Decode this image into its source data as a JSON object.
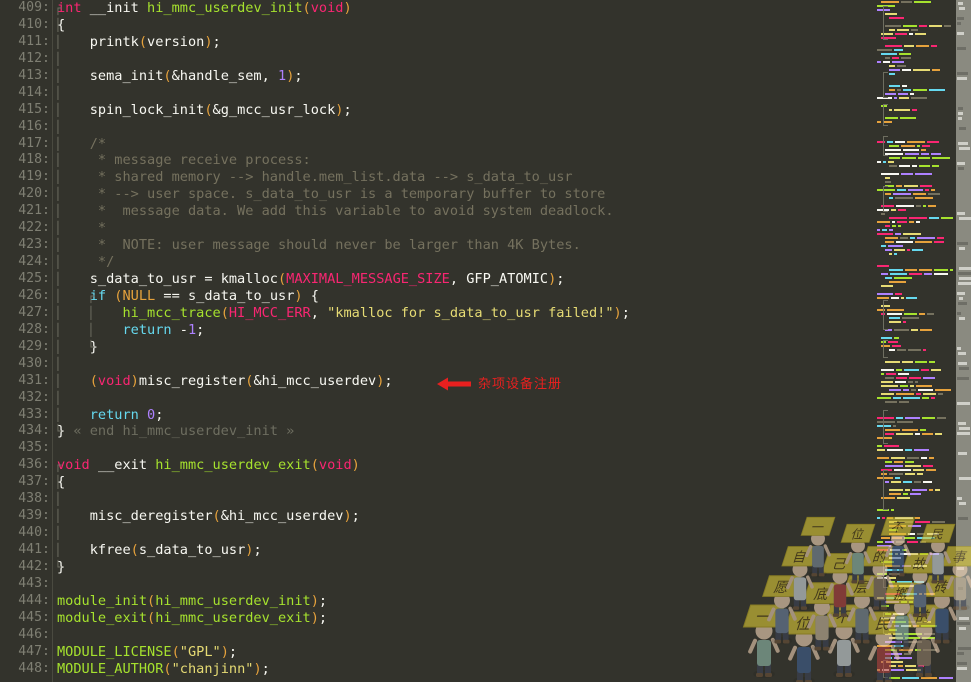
{
  "editor": {
    "theme": "monokai",
    "background": "#33332c",
    "gutter_color": "#7f7f73",
    "first_line": 409,
    "last_line": 448,
    "lines": [
      {
        "n": 409,
        "fold": "open",
        "tokens": [
          {
            "t": "int",
            "c": "kw"
          },
          {
            "t": " ",
            "c": "pln"
          },
          {
            "t": "__init",
            "c": "pln"
          },
          {
            "t": " ",
            "c": "pln"
          },
          {
            "t": "hi_mmc_userdev_init",
            "c": "fn"
          },
          {
            "t": "(",
            "c": "par"
          },
          {
            "t": "void",
            "c": "kw"
          },
          {
            "t": ")",
            "c": "par"
          }
        ]
      },
      {
        "n": 410,
        "fold": "bar",
        "tokens": [
          {
            "t": "{",
            "c": "pln"
          }
        ]
      },
      {
        "n": 411,
        "fold": "bar",
        "tokens": [
          {
            "t": "    printk",
            "c": "pln"
          },
          {
            "t": "(",
            "c": "par"
          },
          {
            "t": "version",
            "c": "pln"
          },
          {
            "t": ")",
            "c": "par"
          },
          {
            "t": ";",
            "c": "pln"
          }
        ]
      },
      {
        "n": 412,
        "fold": "bar",
        "tokens": []
      },
      {
        "n": 413,
        "fold": "bar",
        "tokens": [
          {
            "t": "    sema_init",
            "c": "pln"
          },
          {
            "t": "(",
            "c": "par"
          },
          {
            "t": "&handle_sem, ",
            "c": "pln"
          },
          {
            "t": "1",
            "c": "num"
          },
          {
            "t": ")",
            "c": "par"
          },
          {
            "t": ";",
            "c": "pln"
          }
        ]
      },
      {
        "n": 414,
        "fold": "bar",
        "tokens": []
      },
      {
        "n": 415,
        "fold": "bar",
        "tokens": [
          {
            "t": "    spin_lock_init",
            "c": "pln"
          },
          {
            "t": "(",
            "c": "par"
          },
          {
            "t": "&g_mcc_usr_lock",
            "c": "pln"
          },
          {
            "t": ")",
            "c": "par"
          },
          {
            "t": ";",
            "c": "pln"
          }
        ]
      },
      {
        "n": 416,
        "fold": "bar",
        "tokens": []
      },
      {
        "n": 417,
        "fold": "bar",
        "tokens": [
          {
            "t": "    /*",
            "c": "cmt"
          }
        ]
      },
      {
        "n": 418,
        "fold": "bar",
        "tokens": [
          {
            "t": "     * message receive process:",
            "c": "cmt"
          }
        ]
      },
      {
        "n": 419,
        "fold": "bar",
        "tokens": [
          {
            "t": "     * shared memory --> handle.mem_list.data --> s_data_to_usr",
            "c": "cmt"
          }
        ]
      },
      {
        "n": 420,
        "fold": "bar",
        "tokens": [
          {
            "t": "     * --> user space. s_data_to_usr is a temporary buffer to store",
            "c": "cmt"
          }
        ]
      },
      {
        "n": 421,
        "fold": "bar",
        "tokens": [
          {
            "t": "     *  message data. We add this variable to avoid system deadlock.",
            "c": "cmt"
          }
        ]
      },
      {
        "n": 422,
        "fold": "bar",
        "tokens": [
          {
            "t": "     *",
            "c": "cmt"
          }
        ]
      },
      {
        "n": 423,
        "fold": "bar",
        "tokens": [
          {
            "t": "     *  NOTE: user message should never be larger than 4K Bytes.",
            "c": "cmt"
          }
        ]
      },
      {
        "n": 424,
        "fold": "bar",
        "tokens": [
          {
            "t": "     */",
            "c": "cmt"
          }
        ]
      },
      {
        "n": 425,
        "fold": "bar",
        "tokens": [
          {
            "t": "    s_data_to_usr = ",
            "c": "pln"
          },
          {
            "t": "kmalloc",
            "c": "pln"
          },
          {
            "t": "(",
            "c": "par"
          },
          {
            "t": "MAXIMAL_MESSAGE_SIZE",
            "c": "cst"
          },
          {
            "t": ", GFP_ATOMIC",
            "c": "pln"
          },
          {
            "t": ")",
            "c": "par"
          },
          {
            "t": ";",
            "c": "pln"
          }
        ]
      },
      {
        "n": 426,
        "fold": "bar",
        "inner": "open",
        "tokens": [
          {
            "t": "    ",
            "c": "pln"
          },
          {
            "t": "if",
            "c": "ctl"
          },
          {
            "t": " (",
            "c": "par"
          },
          {
            "t": "NULL",
            "c": "par"
          },
          {
            "t": " == s_data_to_usr",
            "c": "pln"
          },
          {
            "t": ")",
            "c": "par"
          },
          {
            "t": " {",
            "c": "pln"
          }
        ]
      },
      {
        "n": 427,
        "fold": "bar",
        "inner": "bar",
        "tokens": [
          {
            "t": "        hi_mcc_trace",
            "c": "fn"
          },
          {
            "t": "(",
            "c": "par"
          },
          {
            "t": "HI_MCC_ERR",
            "c": "cst"
          },
          {
            "t": ", ",
            "c": "pln"
          },
          {
            "t": "\"kmalloc for s_data_to_usr failed!\"",
            "c": "str"
          },
          {
            "t": ")",
            "c": "par"
          },
          {
            "t": ";",
            "c": "pln"
          }
        ]
      },
      {
        "n": 428,
        "fold": "bar",
        "inner": "bar",
        "tokens": [
          {
            "t": "        ",
            "c": "pln"
          },
          {
            "t": "return",
            "c": "ctl"
          },
          {
            "t": " -",
            "c": "pln"
          },
          {
            "t": "1",
            "c": "num"
          },
          {
            "t": ";",
            "c": "pln"
          }
        ]
      },
      {
        "n": 429,
        "fold": "bar",
        "inner": "close",
        "tokens": [
          {
            "t": "    }",
            "c": "pln"
          }
        ]
      },
      {
        "n": 430,
        "fold": "bar",
        "tokens": []
      },
      {
        "n": 431,
        "fold": "bar",
        "tokens": [
          {
            "t": "    (",
            "c": "par"
          },
          {
            "t": "void",
            "c": "kw"
          },
          {
            "t": ")",
            "c": "par"
          },
          {
            "t": "misc_register",
            "c": "pln"
          },
          {
            "t": "(",
            "c": "par"
          },
          {
            "t": "&hi_mcc_userdev",
            "c": "pln"
          },
          {
            "t": ")",
            "c": "par"
          },
          {
            "t": ";",
            "c": "pln"
          }
        ]
      },
      {
        "n": 432,
        "fold": "bar",
        "tokens": []
      },
      {
        "n": 433,
        "fold": "bar",
        "tokens": [
          {
            "t": "    ",
            "c": "pln"
          },
          {
            "t": "return",
            "c": "ctl"
          },
          {
            "t": " ",
            "c": "pln"
          },
          {
            "t": "0",
            "c": "num"
          },
          {
            "t": ";",
            "c": "pln"
          }
        ]
      },
      {
        "n": 434,
        "fold": "close",
        "tokens": [
          {
            "t": "}",
            "c": "pln"
          },
          {
            "t": " « end hi_mmc_userdev_init »",
            "c": "dim"
          }
        ]
      },
      {
        "n": 435,
        "tokens": []
      },
      {
        "n": 436,
        "fold": "open",
        "tokens": [
          {
            "t": "void",
            "c": "kw"
          },
          {
            "t": " ",
            "c": "pln"
          },
          {
            "t": "__exit",
            "c": "pln"
          },
          {
            "t": " ",
            "c": "pln"
          },
          {
            "t": "hi_mmc_userdev_exit",
            "c": "fn"
          },
          {
            "t": "(",
            "c": "par"
          },
          {
            "t": "void",
            "c": "kw"
          },
          {
            "t": ")",
            "c": "par"
          }
        ]
      },
      {
        "n": 437,
        "fold": "bar",
        "tokens": [
          {
            "t": "{",
            "c": "pln"
          }
        ]
      },
      {
        "n": 438,
        "fold": "bar",
        "tokens": []
      },
      {
        "n": 439,
        "fold": "bar",
        "tokens": [
          {
            "t": "    misc_deregister",
            "c": "pln"
          },
          {
            "t": "(",
            "c": "par"
          },
          {
            "t": "&hi_mcc_userdev",
            "c": "pln"
          },
          {
            "t": ")",
            "c": "par"
          },
          {
            "t": ";",
            "c": "pln"
          }
        ]
      },
      {
        "n": 440,
        "fold": "bar",
        "tokens": []
      },
      {
        "n": 441,
        "fold": "bar",
        "tokens": [
          {
            "t": "    kfree",
            "c": "pln"
          },
          {
            "t": "(",
            "c": "par"
          },
          {
            "t": "s_data_to_usr",
            "c": "pln"
          },
          {
            "t": ")",
            "c": "par"
          },
          {
            "t": ";",
            "c": "pln"
          }
        ]
      },
      {
        "n": 442,
        "fold": "close",
        "tokens": [
          {
            "t": "}",
            "c": "pln"
          }
        ]
      },
      {
        "n": 443,
        "tokens": []
      },
      {
        "n": 444,
        "tokens": [
          {
            "t": "module_init",
            "c": "fn"
          },
          {
            "t": "(",
            "c": "par"
          },
          {
            "t": "hi_mmc_userdev_init",
            "c": "fn"
          },
          {
            "t": ")",
            "c": "par"
          },
          {
            "t": ";",
            "c": "pln"
          }
        ]
      },
      {
        "n": 445,
        "tokens": [
          {
            "t": "module_exit",
            "c": "fn"
          },
          {
            "t": "(",
            "c": "par"
          },
          {
            "t": "hi_mmc_userdev_exit",
            "c": "fn"
          },
          {
            "t": ")",
            "c": "par"
          },
          {
            "t": ";",
            "c": "pln"
          }
        ]
      },
      {
        "n": 446,
        "tokens": []
      },
      {
        "n": 447,
        "tokens": [
          {
            "t": "MODULE_LICENSE",
            "c": "fn"
          },
          {
            "t": "(",
            "c": "par"
          },
          {
            "t": "\"GPL\"",
            "c": "str"
          },
          {
            "t": ")",
            "c": "par"
          },
          {
            "t": ";",
            "c": "pln"
          }
        ]
      },
      {
        "n": 448,
        "tokens": [
          {
            "t": "MODULE_AUTHOR",
            "c": "fn"
          },
          {
            "t": "(",
            "c": "par"
          },
          {
            "t": "\"chanjinn\"",
            "c": "str"
          },
          {
            "t": ")",
            "c": "par"
          },
          {
            "t": ";",
            "c": "pln"
          }
        ]
      }
    ]
  },
  "annotation": {
    "text": "杂项设备注册",
    "color": "#e8201f",
    "arrow_direction": "left"
  },
  "minimap": {
    "present": true,
    "background": "#33332c"
  },
  "scrollbar": {
    "present": true,
    "color": "#8a8a80"
  },
  "watermark": {
    "description": "cartoon crowd holding yellow signs",
    "sign_color": "#d8c637",
    "sign_text_chars": [
      "一",
      "位",
      "不",
      "民",
      "的",
      "愿",
      "底",
      "层",
      "搬",
      "砖",
      "自",
      "己",
      "的",
      "故",
      "事"
    ]
  }
}
